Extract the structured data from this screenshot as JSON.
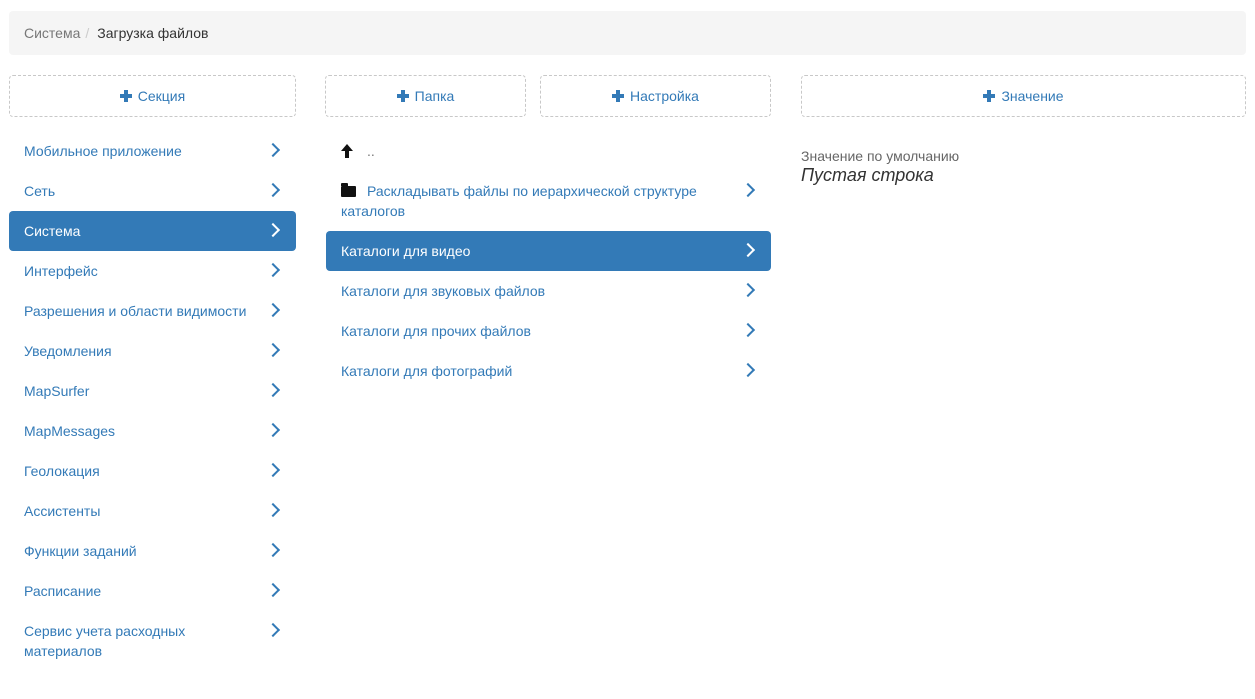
{
  "breadcrumb": {
    "parent": "Система",
    "separator": "/",
    "current": "Загрузка файлов"
  },
  "buttons": {
    "section": "Секция",
    "folder": "Папка",
    "setting": "Настройка",
    "value": "Значение"
  },
  "sections": [
    {
      "label": "Мобильное приложение",
      "active": false
    },
    {
      "label": "Сеть",
      "active": false
    },
    {
      "label": "Система",
      "active": true
    },
    {
      "label": "Интерфейс",
      "active": false
    },
    {
      "label": "Разрешения и области видимости",
      "active": false
    },
    {
      "label": "Уведомления",
      "active": false
    },
    {
      "label": "MapSurfer",
      "active": false
    },
    {
      "label": "MapMessages",
      "active": false
    },
    {
      "label": "Геолокация",
      "active": false
    },
    {
      "label": "Ассистенты",
      "active": false
    },
    {
      "label": "Функции заданий",
      "active": false
    },
    {
      "label": "Расписание",
      "active": false
    },
    {
      "label": "Сервис учета расходных материалов",
      "active": false
    }
  ],
  "folder_list": {
    "up_label": "..",
    "folder_item": "Раскладывать файлы по иерархической структуре каталогов",
    "settings": [
      {
        "label": "Каталоги для видео",
        "active": true
      },
      {
        "label": "Каталоги для звуковых файлов",
        "active": false
      },
      {
        "label": "Каталоги для прочих файлов",
        "active": false
      },
      {
        "label": "Каталоги для фотографий",
        "active": false
      }
    ]
  },
  "value_panel": {
    "label": "Значение по умолчанию",
    "value": "Пустая строка"
  },
  "colors": {
    "accent": "#337ab7",
    "breadcrumb_bg": "#f5f5f5"
  }
}
